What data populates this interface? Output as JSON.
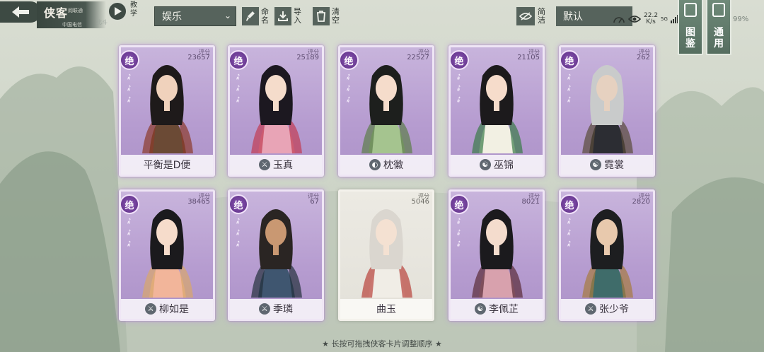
{
  "header": {
    "title": "侠客",
    "subtitle_line1": "阅联通",
    "subtitle_line2": "中国电信",
    "subtitle_extra": "北斗",
    "tutorial_label": "教学"
  },
  "filters": {
    "category": "娱乐",
    "rename_label": "命名",
    "import_label": "导入",
    "clear_label": "清空",
    "simple_label": "简洁",
    "sort": "默认"
  },
  "status": {
    "speed_value": "22.2",
    "speed_unit": "K/s",
    "network": "5G",
    "battery": "99%"
  },
  "right_tabs": {
    "codex_label": "图鉴",
    "general_label": "通用"
  },
  "score_label": "评分",
  "cards": [
    {
      "name": "平衡是D便",
      "score": "23657",
      "rank": "绝",
      "school_icon": "",
      "plain": false,
      "palette": "brown"
    },
    {
      "name": "玉真",
      "score": "25189",
      "rank": "绝",
      "school_icon": "⚔",
      "plain": false,
      "palette": "pink"
    },
    {
      "name": "枕徽",
      "score": "22527",
      "rank": "绝",
      "school_icon": "◐",
      "plain": false,
      "palette": "green"
    },
    {
      "name": "巫锦",
      "score": "21105",
      "rank": "绝",
      "school_icon": "☯",
      "plain": false,
      "palette": "white"
    },
    {
      "name": "霓裳",
      "score": "262",
      "rank": "绝",
      "school_icon": "☯",
      "plain": false,
      "palette": "dark"
    },
    {
      "name": "柳如是",
      "score": "38465",
      "rank": "绝",
      "school_icon": "⚔",
      "plain": false,
      "palette": "peach"
    },
    {
      "name": "季璘",
      "score": "67",
      "rank": "绝",
      "school_icon": "⚔",
      "plain": false,
      "palette": "blue"
    },
    {
      "name": "曲玉",
      "score": "5046",
      "rank": "",
      "school_icon": "",
      "plain": true,
      "palette": "cream"
    },
    {
      "name": "李佩芷",
      "score": "8021",
      "rank": "绝",
      "school_icon": "☯",
      "plain": false,
      "palette": "rose"
    },
    {
      "name": "张少爷",
      "score": "2820",
      "rank": "绝",
      "school_icon": "⚔",
      "plain": false,
      "palette": "teal"
    }
  ],
  "hint": "★ 长按可拖拽侠客卡片调整顺序 ★"
}
